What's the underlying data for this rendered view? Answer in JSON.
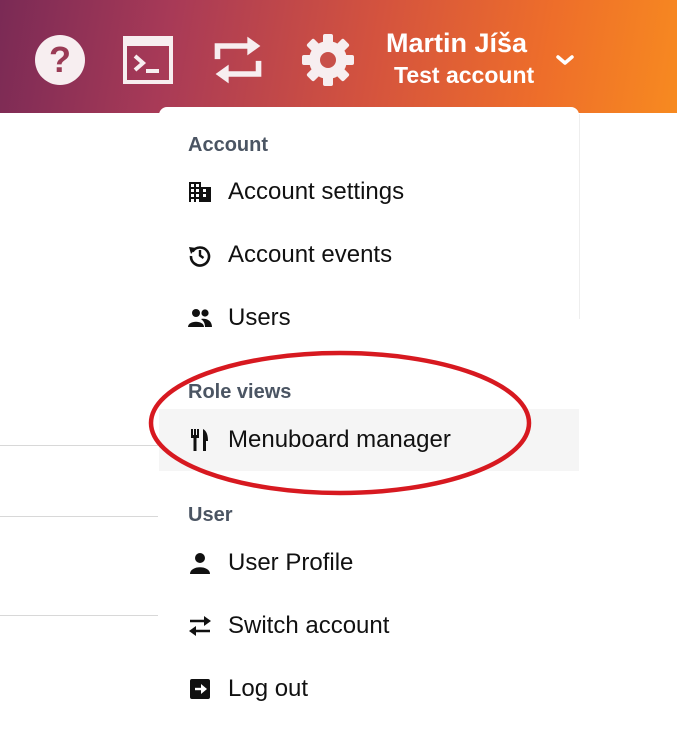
{
  "header": {
    "icons": [
      "help-icon",
      "terminal-icon",
      "sync-icon",
      "gear-icon"
    ],
    "user_name": "Martin Jíša",
    "account_name": "Test account"
  },
  "menu": {
    "sections": [
      {
        "title": "Account",
        "items": [
          {
            "label": "Account settings",
            "icon": "building-icon"
          },
          {
            "label": "Account events",
            "icon": "history-icon"
          },
          {
            "label": "Users",
            "icon": "users-icon"
          }
        ]
      },
      {
        "title": "Role views",
        "items": [
          {
            "label": "Menuboard manager",
            "icon": "utensils-icon"
          }
        ]
      },
      {
        "title": "User",
        "items": [
          {
            "label": "User Profile",
            "icon": "user-icon"
          },
          {
            "label": "Switch account",
            "icon": "swap-icon"
          },
          {
            "label": "Log out",
            "icon": "logout-icon"
          }
        ]
      }
    ]
  },
  "colors": {
    "highlight_ellipse": "#d71920",
    "header_start": "#7a2a55",
    "header_end": "#f78a20"
  }
}
